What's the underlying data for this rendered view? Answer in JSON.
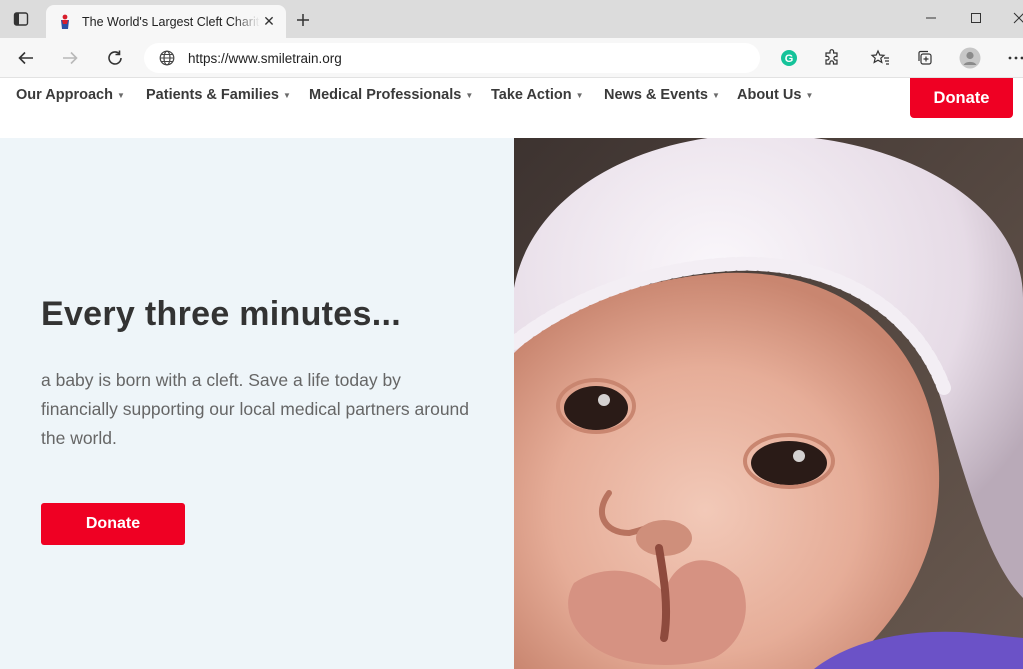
{
  "browser": {
    "tab_title": "The World's Largest Cleft Charity",
    "url": "https://www.smiletrain.org"
  },
  "nav": {
    "items": [
      {
        "label": "Our Approach"
      },
      {
        "label": "Patients & Families"
      },
      {
        "label": "Medical Professionals"
      },
      {
        "label": "Take Action"
      },
      {
        "label": "News & Events"
      },
      {
        "label": "About Us"
      }
    ],
    "donate_label": "Donate"
  },
  "hero": {
    "headline": "Every three minutes...",
    "subtext": "a baby is born with a cleft. Save a life today by financially supporting our local medical partners around the world.",
    "donate_label": "Donate"
  },
  "colors": {
    "brand_red": "#ef0023",
    "hero_bg": "#eef5f9",
    "grammarly_green": "#15c39a"
  },
  "icons": [
    "sidebar-toggle-icon",
    "favicon-icon",
    "close-icon",
    "plus-icon",
    "minimize-icon",
    "maximize-icon",
    "window-close-icon",
    "back-arrow-icon",
    "forward-arrow-icon",
    "refresh-icon",
    "globe-icon",
    "grammarly-icon",
    "extensions-icon",
    "favorites-icon",
    "collections-icon",
    "profile-icon",
    "more-icon",
    "caret-down-icon"
  ]
}
